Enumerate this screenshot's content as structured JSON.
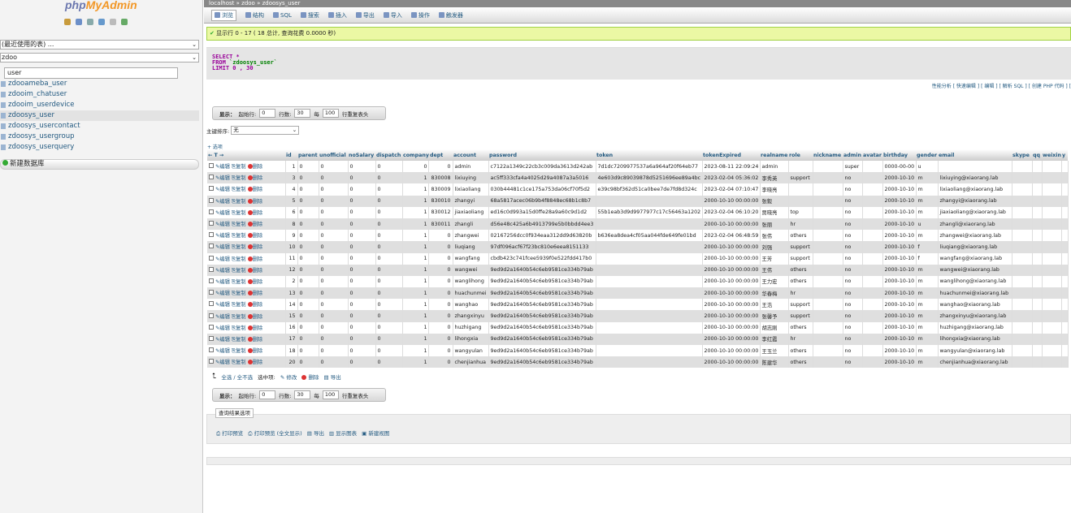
{
  "sidebar": {
    "logo_a": "php",
    "logo_b": "MyAdmin",
    "recent": "(最近使用的表) ...",
    "db": "zdoo",
    "filter": "user",
    "tables": [
      "zdooameba_user",
      "zdooim_chatuser",
      "zdooim_userdevice",
      "zdoosys_user",
      "zdoosys_usercontact",
      "zdoosys_usergroup",
      "zdoosys_userquery"
    ],
    "new_db": "新建数据库"
  },
  "breadcrumb": "localhost » zdoo » zdoosys_user",
  "tabs": [
    "浏览",
    "结构",
    "SQL",
    "搜索",
    "插入",
    "导出",
    "导入",
    "操作",
    "触发器"
  ],
  "success": "显示行 0 - 17 ( 18 总计, 查询花费 0.0000 秒)",
  "sql": {
    "l1": "SELECT *",
    "l2a": "FROM ",
    "l2b": "`zdoosys_user`",
    "l3": "LIMIT 0 , 30"
  },
  "sql_links": "性能分析 [ 快速编辑 ] [ 编辑 ] [ 解析 SQL ] [ 创建 PHP 代码 ] [",
  "nav": {
    "show": "显示：",
    "start": "起始行:",
    "start_val": "0",
    "rows": "行数:",
    "rows_val": "30",
    "per": "每",
    "per_val": "100",
    "repeat": "行重复表头"
  },
  "sort": {
    "label": "主键排序:",
    "value": "无"
  },
  "options": "+ 选项",
  "columns": [
    "id",
    "parent",
    "unofficial",
    "noSalary",
    "dispatch",
    "company",
    "dept",
    "account",
    "password",
    "token",
    "tokenExpired",
    "realname",
    "role",
    "nickname",
    "admin",
    "avatar",
    "birthday",
    "gender",
    "email",
    "skype",
    "qq",
    "weixin",
    "y"
  ],
  "actions": {
    "edit": "编辑",
    "copy": "复制",
    "del": "删除"
  },
  "rows": [
    [
      "1",
      "0",
      "0",
      "0",
      "0",
      "0",
      "0",
      "admin",
      "c7122a1349c22cb3c009da3613d242ab",
      "7d1dc7209977537a6a964af20f64eb77",
      "2023-08-11 22:09:24",
      "admin",
      "",
      "",
      "super",
      "",
      "0000-00-00",
      "u",
      ""
    ],
    [
      "3",
      "0",
      "0",
      "0",
      "0",
      "1",
      "830008",
      "lixiuying",
      "ac5ff333cfa4a4025d29a4087a3a5016",
      "4e603d9c89039878d5251696ee89a4bc",
      "2023-02-04 05:36:02",
      "李秀英",
      "support",
      "",
      "no",
      "",
      "2000-10-10",
      "m",
      "lixiuying@xiaorang.lab"
    ],
    [
      "4",
      "0",
      "0",
      "0",
      "0",
      "1",
      "830009",
      "lixiaoliang",
      "030b44481c1ce175a753da06cf70f5d2",
      "e39c98bf362d51ca0bee7de7fd8d324c",
      "2023-02-04 07:10:47",
      "李晓亮",
      "",
      "",
      "no",
      "",
      "2000-10-10",
      "m",
      "lixiaoliang@xiaorang.lab"
    ],
    [
      "5",
      "0",
      "0",
      "0",
      "0",
      "1",
      "830010",
      "zhangyi",
      "68a5817acec06b9b4f8848ec68b1c8b7",
      "",
      "2000-10-10 00:00:00",
      "张毅",
      "",
      "",
      "no",
      "",
      "2000-10-10",
      "m",
      "zhangyi@xiaorang.lab"
    ],
    [
      "6",
      "0",
      "0",
      "0",
      "0",
      "1",
      "830012",
      "jiaxiaoliang",
      "ed16c0d993a15d0ffe28a9a60c9d1d2",
      "55b1eab3d9d9977977c17c56463a1202",
      "2023-02-04 06:10:20",
      "贾晓亮",
      "top",
      "",
      "no",
      "",
      "2000-10-10",
      "m",
      "jiaxiaoliang@xiaorang.lab"
    ],
    [
      "8",
      "0",
      "0",
      "0",
      "0",
      "1",
      "830011",
      "zhangli",
      "d56e48c425a6b4913799e5b0bbdd4ee3",
      "",
      "2000-10-10 00:00:00",
      "张丽",
      "hr",
      "",
      "no",
      "",
      "2000-10-10",
      "u",
      "zhangli@xiaorang.lab"
    ],
    [
      "9",
      "0",
      "0",
      "0",
      "0",
      "1",
      "0",
      "zhangwei",
      "02167256dcc0f934eaa312dd9d63820b",
      "b636ea8dea4cf05aa044fde649fe01bd",
      "2023-02-04 06:48:59",
      "张伟",
      "others",
      "",
      "no",
      "",
      "2000-10-10",
      "m",
      "zhangwei@xiaorang.lab"
    ],
    [
      "10",
      "0",
      "0",
      "0",
      "0",
      "1",
      "0",
      "liuqiang",
      "97df096acf67f23bc810e6eea8151133",
      "",
      "2000-10-10 00:00:00",
      "刘强",
      "support",
      "",
      "no",
      "",
      "2000-10-10",
      "f",
      "liuqiang@xiaorang.lab"
    ],
    [
      "11",
      "0",
      "0",
      "0",
      "0",
      "1",
      "0",
      "wangfang",
      "cbdb423c741fcee5939f0e522fdd417b0",
      "",
      "2000-10-10 00:00:00",
      "王芳",
      "support",
      "",
      "no",
      "",
      "2000-10-10",
      "f",
      "wangfang@xiaorang.lab"
    ],
    [
      "12",
      "0",
      "0",
      "0",
      "0",
      "1",
      "0",
      "wangwei",
      "9ed9d2a1640b54c6eb9581ce334b79ab",
      "",
      "2000-10-10 00:00:00",
      "王伟",
      "others",
      "",
      "no",
      "",
      "2000-10-10",
      "m",
      "wangwei@xiaorang.lab"
    ],
    [
      "2",
      "0",
      "0",
      "0",
      "0",
      "1",
      "0",
      "wanglihong",
      "9ed9d2a1640b54c6eb9581ce334b79ab",
      "",
      "2000-10-10 00:00:00",
      "王力宏",
      "others",
      "",
      "no",
      "",
      "2000-10-10",
      "m",
      "wanglihong@xiaorang.lab"
    ],
    [
      "13",
      "0",
      "0",
      "0",
      "0",
      "1",
      "0",
      "huachunmei",
      "9ed9d2a1640b54c6eb9581ce334b79ab",
      "",
      "2000-10-10 00:00:00",
      "华春梅",
      "hr",
      "",
      "no",
      "",
      "2000-10-10",
      "m",
      "huachunmei@xiaorang.lab"
    ],
    [
      "14",
      "0",
      "0",
      "0",
      "0",
      "1",
      "0",
      "wanghao",
      "9ed9d2a1640b54c6eb9581ce334b79ab",
      "",
      "2000-10-10 00:00:00",
      "王浩",
      "support",
      "",
      "no",
      "",
      "2000-10-10",
      "m",
      "wanghao@xiaorang.lab"
    ],
    [
      "15",
      "0",
      "0",
      "0",
      "0",
      "1",
      "0",
      "zhangxinyu",
      "9ed9d2a1640b54c6eb9581ce334b79ab",
      "",
      "2000-10-10 00:00:00",
      "张馨予",
      "support",
      "",
      "no",
      "",
      "2000-10-10",
      "m",
      "zhangxinyu@xiaorang.lab"
    ],
    [
      "16",
      "0",
      "0",
      "0",
      "0",
      "1",
      "0",
      "huzhigang",
      "9ed9d2a1640b54c6eb9581ce334b79ab",
      "",
      "2000-10-10 00:00:00",
      "胡志刚",
      "others",
      "",
      "no",
      "",
      "2000-10-10",
      "m",
      "huzhigang@xiaorang.lab"
    ],
    [
      "17",
      "0",
      "0",
      "0",
      "0",
      "1",
      "0",
      "lihongxia",
      "9ed9d2a1640b54c6eb9581ce334b79ab",
      "",
      "2000-10-10 00:00:00",
      "李红霞",
      "hr",
      "",
      "no",
      "",
      "2000-10-10",
      "m",
      "lihongxia@xiaorang.lab"
    ],
    [
      "18",
      "0",
      "0",
      "0",
      "0",
      "1",
      "0",
      "wangyulan",
      "9ed9d2a1640b54c6eb9581ce334b79ab",
      "",
      "2000-10-10 00:00:00",
      "王玉兰",
      "others",
      "",
      "no",
      "",
      "2000-10-10",
      "m",
      "wangyulan@xiaorang.lab"
    ],
    [
      "20",
      "0",
      "0",
      "0",
      "0",
      "1",
      "0",
      "chenjianhua",
      "9ed9d2a1640b54c6eb9581ce334b79ab",
      "",
      "2000-10-10 00:00:00",
      "陈建华",
      "others",
      "",
      "no",
      "",
      "2000-10-10",
      "m",
      "chenjianhua@xiaorang.lab"
    ]
  ],
  "multi": {
    "check_all": "全选 / 全不选",
    "selected": "选中项:",
    "edit": "修改",
    "del": "删除",
    "export": "导出"
  },
  "qro": {
    "title": "查询结果选项",
    "print": "打印预览",
    "print_full": "打印预览 (全文显示)",
    "export": "导出",
    "chart": "显示图表",
    "view": "新建视图"
  }
}
